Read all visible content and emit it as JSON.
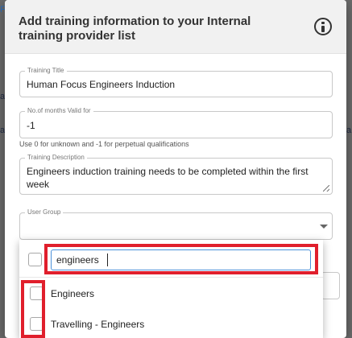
{
  "background": {
    "fragments": [
      "F",
      "a",
      "al",
      "a"
    ]
  },
  "dialog": {
    "title": "Add training information to your Internal training provider list",
    "icon": "info-icon"
  },
  "fields": {
    "training_title": {
      "label": "Training Title",
      "value": "Human Focus Engineers Induction"
    },
    "months_valid": {
      "label": "No.of months Valid for",
      "value": "-1",
      "hint": "Use 0 for unknown and -1 for perpetual qualifications"
    },
    "description": {
      "label": "Training Description",
      "value": "Engineers induction training needs to be completed within the first week"
    },
    "user_group": {
      "label": "User Group",
      "value": ""
    }
  },
  "dropdown": {
    "search_value": "engineers",
    "options": [
      {
        "label": "Engineers",
        "checked": false
      },
      {
        "label": "Travelling - Engineers",
        "checked": false
      }
    ]
  },
  "colors": {
    "highlight": "#e01f2c",
    "focus_border": "#4a90d9",
    "header_bg": "#f1f1f1"
  }
}
